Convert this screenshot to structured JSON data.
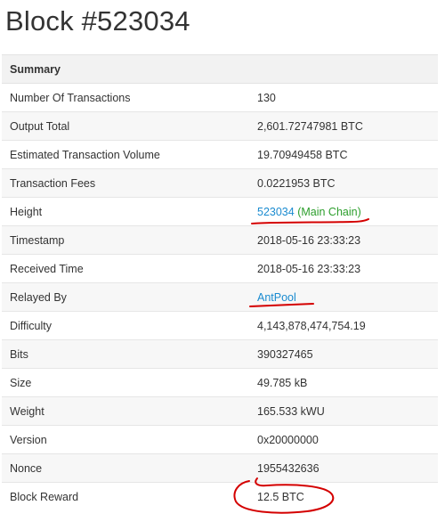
{
  "page_title": "Block #523034",
  "summary": {
    "header": "Summary",
    "rows": [
      {
        "label": "Number Of Transactions",
        "value": "130"
      },
      {
        "label": "Output Total",
        "value": "2,601.72747981 BTC"
      },
      {
        "label": "Estimated Transaction Volume",
        "value": "19.70949458 BTC"
      },
      {
        "label": "Transaction Fees",
        "value": "0.0221953 BTC"
      },
      {
        "label": "Height",
        "value": "523034",
        "suffix": "(Main Chain)"
      },
      {
        "label": "Timestamp",
        "value": "2018-05-16 23:33:23"
      },
      {
        "label": "Received Time",
        "value": "2018-05-16 23:33:23"
      },
      {
        "label": "Relayed By",
        "value": "AntPool"
      },
      {
        "label": "Difficulty",
        "value": "4,143,878,474,754.19"
      },
      {
        "label": "Bits",
        "value": "390327465"
      },
      {
        "label": "Size",
        "value": "49.785 kB"
      },
      {
        "label": "Weight",
        "value": "165.533 kWU"
      },
      {
        "label": "Version",
        "value": "0x20000000"
      },
      {
        "label": "Nonce",
        "value": "1955432636"
      },
      {
        "label": "Block Reward",
        "value": "12.5 BTC"
      }
    ]
  },
  "colors": {
    "link": "#1a8bd0",
    "main_chain": "#2c9e2c",
    "annotation": "#d40000"
  }
}
